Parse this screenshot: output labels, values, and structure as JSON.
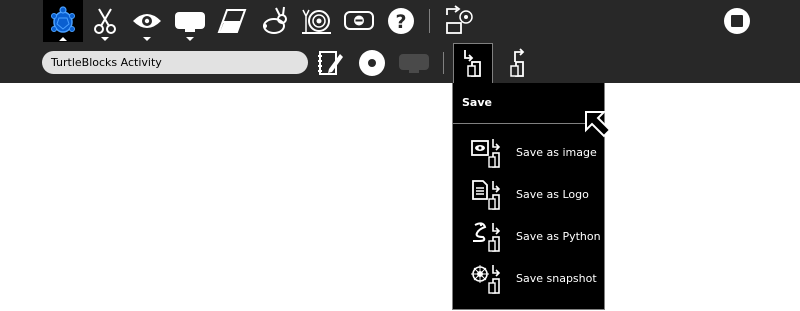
{
  "window": {
    "title": "TurtleBlocks Activity"
  },
  "toolbar": {
    "items": [
      {
        "name": "activity-turtle-button",
        "icon": "turtle-icon",
        "selected": true,
        "arrow": "up"
      },
      {
        "name": "edit-cut-button",
        "icon": "scissors-icon",
        "arrow": "down"
      },
      {
        "name": "view-button",
        "icon": "eye-icon",
        "arrow": "down"
      },
      {
        "name": "palette-button",
        "icon": "palette-icon",
        "arrow": "down"
      },
      {
        "name": "clear-button",
        "icon": "eraser-icon"
      },
      {
        "name": "run-fast-button",
        "icon": "rabbit-icon"
      },
      {
        "name": "run-slow-button",
        "icon": "snail-icon"
      },
      {
        "name": "stop-turtle-button",
        "icon": "stop-turtle-icon"
      },
      {
        "name": "help-button",
        "icon": "question-icon"
      },
      {
        "name": "share-button",
        "icon": "share-icon"
      }
    ],
    "stop_icon": "stop-activity-icon"
  },
  "second_toolbar": {
    "title_value": "TurtleBlocks Activity",
    "icons": [
      "notebook-edit-icon",
      "record-icon",
      "disabled-keep-icon",
      "save-as-icon",
      "load-icon"
    ]
  },
  "save_palette": {
    "title": "Save",
    "items": [
      {
        "label": "Save as image",
        "icon": "save-image-icon"
      },
      {
        "label": "Save as Logo",
        "icon": "save-logo-icon"
      },
      {
        "label": "Save as Python",
        "icon": "save-python-icon"
      },
      {
        "label": "Save snapshot",
        "icon": "save-snapshot-icon"
      }
    ]
  },
  "colors": {
    "toolbar": "#282828",
    "palette": "#000000",
    "accent": "#0a5fd0",
    "entry": "#e2e2e2"
  }
}
